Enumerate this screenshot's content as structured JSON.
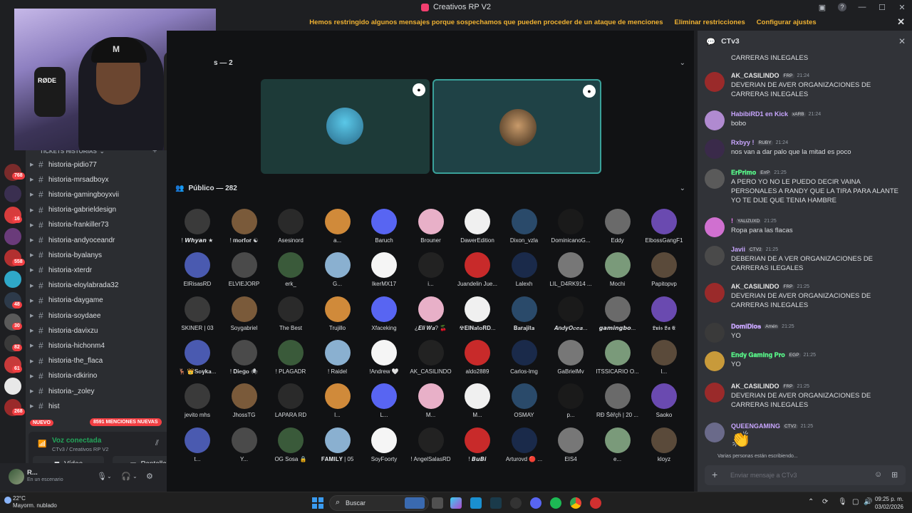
{
  "window": {
    "title": "Creativos RP V2"
  },
  "notice": {
    "text": "Hemos restringido algunos mensajes porque sospechamos que pueden proceder de un ataque de menciones",
    "remove": "Eliminar restricciones",
    "config": "Configurar ajustes"
  },
  "guild_badges": [
    "768",
    "16",
    "558",
    "48",
    "30",
    "82",
    "61",
    "268"
  ],
  "sidebar": {
    "category": "TICKETS HISTORIAS",
    "channels": [
      "historia-pidio77",
      "historia-mrsadboyx",
      "historia-gamingboyxvii",
      "historia-gabrieldesign",
      "historia-frankiller73",
      "historia-andyoceandr",
      "historia-byalanys",
      "historia-xterdr",
      "historia-eloylabrada32",
      "historia-daygame",
      "historia-soydaee",
      "historia-davixzu",
      "historia-hichonm4",
      "historia-the_flaca",
      "historia-rdkirino",
      "historia-_zoley",
      "hist"
    ],
    "nuevo": "NUEVO",
    "mentions": "8591 MENCIONES NUEVAS"
  },
  "voice": {
    "title": "Voz conectada",
    "subtitle": "CTv3 / Creativos RP V2",
    "video": "Vídeo",
    "screen": "Pantalla"
  },
  "user": {
    "name": "R...",
    "status": "En un escenario"
  },
  "stage": {
    "speakers_label": "s — 2",
    "public_label": "Público — 282",
    "audience": [
      "! 𝙒𝙝𝙮𝙖𝙣 ★",
      "! 𝐦𝐨𝐫𝐟𝐨𝐫 ☯",
      "Asesinord",
      "a...",
      "Baruch",
      "Brouner",
      "DawerEdition",
      "Dixon_vzla",
      "DominicanoG...",
      "Eddy",
      "ElbossGangF1",
      "ElRisasRD",
      "ELVIEJORP",
      "erk_",
      "G...",
      "IkerMX17",
      "i...",
      "Juandelin Jue...",
      "Lalexh",
      "LIL_D4RK914 ...",
      "Mochi",
      "Papitopvp",
      "SKINER | 03",
      "Soygabriel",
      "The Best",
      "Trujillo",
      "Xfaceking",
      "¿𝑬𝒍𝒊 𝑾𝒂? 🍒",
      "☢𝐄𝐥𝐍𝐚𝐭𝐨𝐑𝐃...",
      "𝐁𝐚𝐫𝐚𝐣𝐢𝐭𝐚",
      "𝑨𝒏𝒅𝒚𝑶𝒄𝒆𝒂...",
      "𝙜𝙖𝙢𝙞𝙣𝙜𝙗𝙤...",
      "𝕷𝖚𝖎𝖘 𝕷𝖆 𝕰",
      "🦌 👑𝐒𝐨𝐲𝐤𝐚...",
      "! 𝐃𝐢𝐞𝐠𝐨 🕷",
      "! PLAGADR",
      "! Raidel",
      "!Andrew 🤍",
      "AK_CASILINDO",
      "aldo2889",
      "Carlos-lmg",
      "GaBrielMv",
      "ITSSICARIO O...",
      "l...",
      "jevito mhs",
      "JhossTG",
      "LAPARA RD",
      "l...",
      "L...",
      "M...",
      "M...",
      "OSMAY",
      "p...",
      "RÐ Šêřçĥ | 20 ...",
      "Saoko",
      "t...",
      "Y...",
      "OG Sosa 🔒",
      "𝐅𝐀𝐌𝐈𝐋𝐘 | 05",
      "SoyFoorty",
      "! AngelSalasRD",
      "! 𝘽𝙪𝘽𝙞",
      "Arturovd 🔴 ...",
      "EIS4",
      "e...",
      "kloyz"
    ]
  },
  "chat": {
    "title": "CTv3",
    "top_text": "CARRERAS INLEGALES",
    "messages": [
      {
        "user": "AK_CASILINDO",
        "tag": "FRP",
        "time": "21:24",
        "color": "#e8e8e8",
        "text": "DEVERIAN DE AVER ORGANIZACIONES DE CARRERAS INLEGALES"
      },
      {
        "user": "HabibiRD1 en Kick",
        "tag": "xARB",
        "time": "21:24",
        "color": "#c9a6ff",
        "text": "bobo"
      },
      {
        "user": "Rxbyy !",
        "tag": "RUBY",
        "time": "21:24",
        "color": "#c9a6ff",
        "text": "nos van a dar palo que la mitad es poco"
      },
      {
        "user": "𝐄𝐫𝐏𝐫𝐢𝐦𝐨",
        "tag": "ErrP",
        "time": "21:25",
        "color": "#57f287",
        "text": "A PERO YO NO LE PUEDO DECIR VAINA PERSONALES A RANDY QUE LA TIRA PARA ALANTE YO TE DIJE QUE TENIA HAMBRE"
      },
      {
        "user": "!",
        "tag": "YALIZUXD",
        "time": "21:25",
        "color": "#f47fff",
        "text": "Ropa para las flacas"
      },
      {
        "user": "Javii",
        "tag": "CTV2",
        "time": "21:25",
        "color": "#c9a6ff",
        "text": "DEBERIAN DE A VER ORGANIZACIONES DE CARRERAS ILEGALES"
      },
      {
        "user": "AK_CASILINDO",
        "tag": "FRP",
        "time": "21:25",
        "color": "#e8e8e8",
        "text": "DEVERIAN DE AVER ORGANIZACIONES DE CARRERAS INLEGALES"
      },
      {
        "user": "𝐃𝐨𝐦𝐢𝐃𝐢𝐨𝐬",
        "tag": "Amén",
        "time": "21:25",
        "color": "#c9a6ff",
        "text": "YO"
      },
      {
        "user": "𝐄𝐧𝐝𝐲 𝐆𝐚𝐦𝐢𝐧𝐠 𝐏𝐫𝐨",
        "tag": "EGP",
        "time": "21:25",
        "color": "#57f287",
        "text": "YO"
      },
      {
        "user": "AK_CASILINDO",
        "tag": "FRP",
        "time": "21:25",
        "color": "#e8e8e8",
        "text": "DEVERIAN DE AVER ORGANIZACIONES DE CARRERAS INLEGALES"
      },
      {
        "user": "QUEENGAMING",
        "tag": "CTV2",
        "time": "21:25",
        "color": "#c9a6ff",
        "text": "👏"
      }
    ],
    "typing": "Varias personas están escribiendo...",
    "placeholder": "Enviar mensaje a CTv3"
  },
  "taskbar": {
    "temp": "22°C",
    "weather": "Mayorm. nublado",
    "search": "Buscar",
    "time": "09:25 p. m.",
    "date": "03/02/2026"
  }
}
